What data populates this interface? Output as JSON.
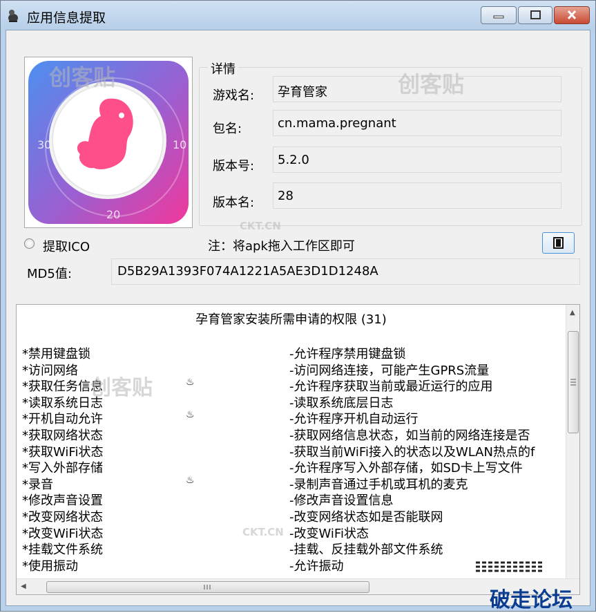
{
  "window": {
    "title": "应用信息提取",
    "colors": {
      "titlebar": "#b9d1ea",
      "close": "#c84a33",
      "accent": "#4a90d9",
      "forum_text": "#0a3d91"
    }
  },
  "logo": {
    "tick_labels": [
      "30",
      "10",
      "20"
    ],
    "colors": {
      "left": "#4d8ff0",
      "right": "#f2379b",
      "embryo": "#ff4f8b"
    }
  },
  "details": {
    "group_label": "详情",
    "fields": [
      {
        "label": "游戏名:",
        "value": "孕育管家"
      },
      {
        "label": "包名:",
        "value": "cn.mama.pregnant"
      },
      {
        "label": "版本号:",
        "value": "5.2.0"
      },
      {
        "label": "版本名:",
        "value": "28"
      }
    ]
  },
  "extract_ico_label": "提取ICO",
  "note": "注：将apk拖入工作区即可",
  "md5": {
    "label": "MD5值:",
    "value": "D5B29A1393F074A1221A5AE3D1D1248A"
  },
  "permissions": {
    "header": "孕育管家安装所需申请的权限 (31)",
    "items": [
      {
        "name": "*禁用键盘锁",
        "flag": "",
        "desc": "-允许程序禁用键盘锁"
      },
      {
        "name": "*访问网络",
        "flag": "",
        "desc": "-访问网络连接，可能产生GPRS流量"
      },
      {
        "name": "*获取任务信息",
        "flag": "♨",
        "desc": "-允许程序获取当前或最近运行的应用"
      },
      {
        "name": "*读取系统日志",
        "flag": "",
        "desc": "-读取系统底层日志"
      },
      {
        "name": "*开机自动允许",
        "flag": "♨",
        "desc": "-允许程序开机自动运行"
      },
      {
        "name": "*获取网络状态",
        "flag": "",
        "desc": "-获取网络信息状态，如当前的网络连接是否"
      },
      {
        "name": "*获取WiFi状态",
        "flag": "",
        "desc": "-获取当前WiFi接入的状态以及WLAN热点的f"
      },
      {
        "name": "*写入外部存储",
        "flag": "",
        "desc": "-允许程序写入外部存储，如SD卡上写文件"
      },
      {
        "name": "*录音",
        "flag": "♨",
        "desc": "-录制声音通过手机或耳机的麦克"
      },
      {
        "name": "*修改声音设置",
        "flag": "",
        "desc": "-修改声音设置信息"
      },
      {
        "name": "*改变网络状态",
        "flag": "",
        "desc": "-改变网络状态如是否能联网"
      },
      {
        "name": "*改变WiFi状态",
        "flag": "",
        "desc": "-改变WiFi状态"
      },
      {
        "name": "*挂载文件系统",
        "flag": "",
        "desc": "-挂载、反挂载外部文件系统"
      },
      {
        "name": "*使用振动",
        "flag": "",
        "desc": "-允许振动"
      }
    ]
  },
  "scroll": {
    "vertical_fraction": 0.37,
    "horizontal_fraction": 0.6
  },
  "watermarks": [
    "创客贴",
    "创客贴",
    "创客贴",
    "CKT.CN",
    "CKT.CN"
  ],
  "forum": "破走论坛"
}
